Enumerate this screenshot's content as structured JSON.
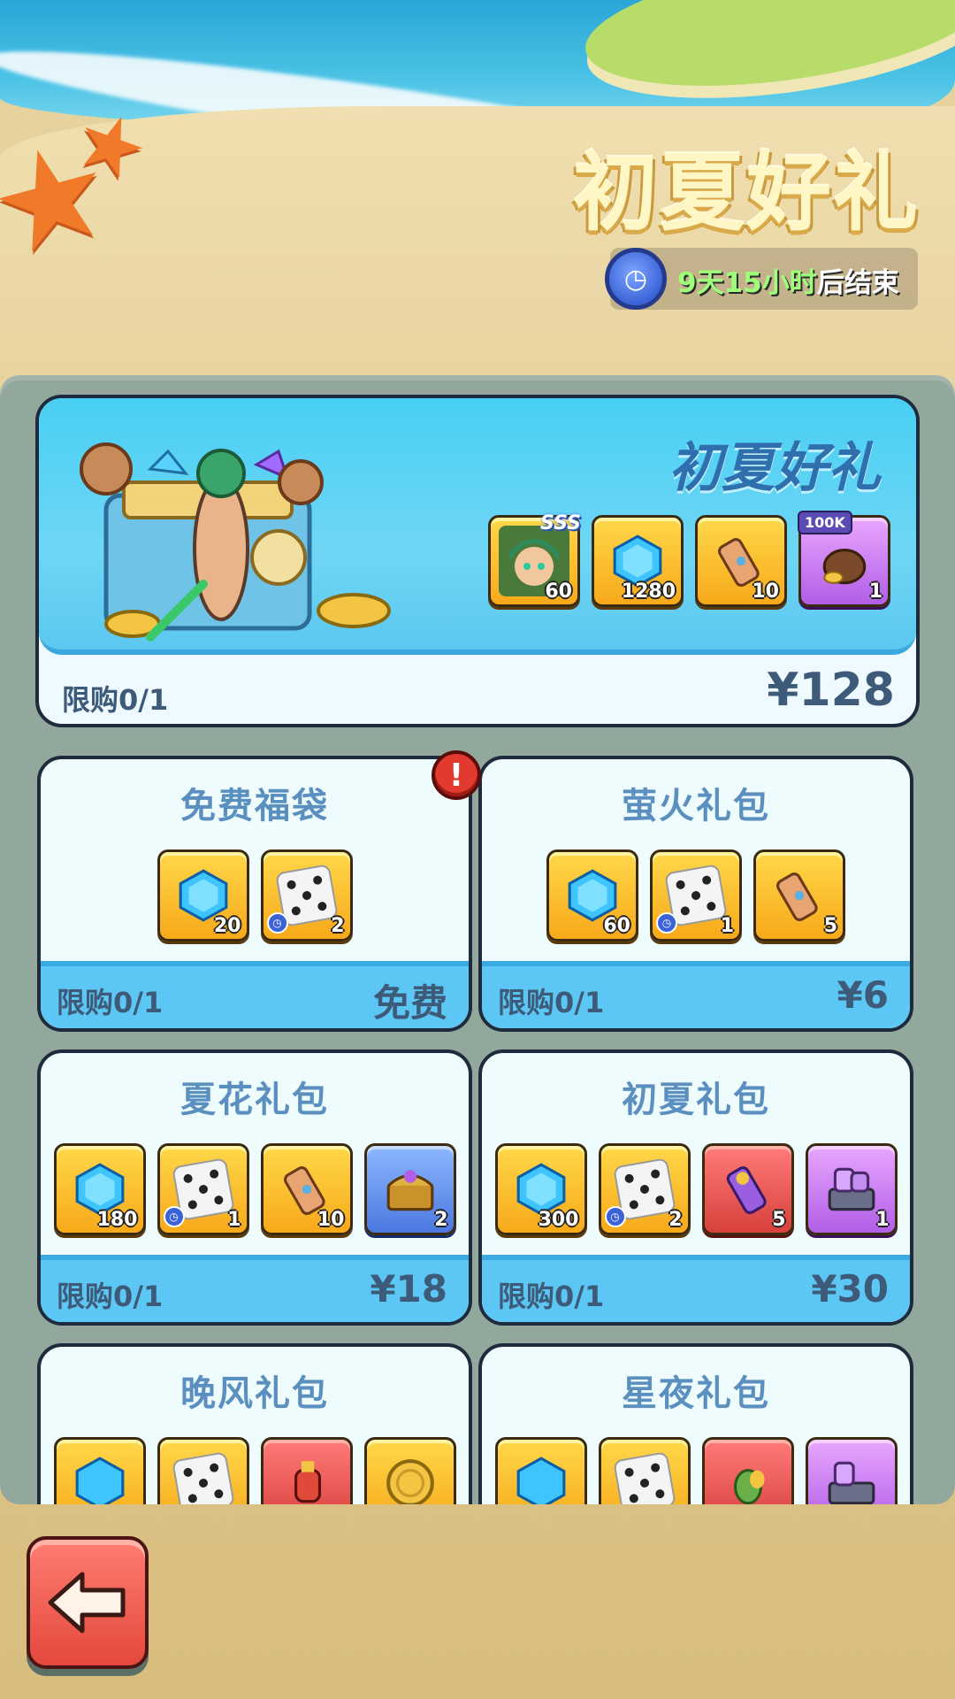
{
  "header": {
    "title": "初夏好礼",
    "timer_highlight": "9天15小时",
    "timer_suffix": "后结束"
  },
  "featured": {
    "title": "初夏好礼",
    "limit": "限购0/1",
    "price": "¥128",
    "items": [
      {
        "icon": "hero-portrait-icon",
        "qty": "60",
        "badge_right": "SSS"
      },
      {
        "icon": "blue-gem-icon",
        "qty": "1280"
      },
      {
        "icon": "scroll-icon",
        "qty": "10"
      },
      {
        "icon": "coin-bag-icon",
        "qty": "1",
        "badge_left": "100K"
      }
    ]
  },
  "packs": [
    {
      "title": "免费福袋",
      "limit": "限购0/1",
      "price": "免费",
      "items": [
        {
          "icon": "blue-gem-icon",
          "qty": "20"
        },
        {
          "icon": "dice-icon",
          "qty": "2",
          "timed": true
        }
      ]
    },
    {
      "title": "萤火礼包",
      "limit": "限购0/1",
      "price": "¥6",
      "items": [
        {
          "icon": "blue-gem-icon",
          "qty": "60"
        },
        {
          "icon": "dice-icon",
          "qty": "1",
          "timed": true
        },
        {
          "icon": "scroll-icon",
          "qty": "5"
        }
      ]
    },
    {
      "title": "夏花礼包",
      "limit": "限购0/1",
      "price": "¥18",
      "items": [
        {
          "icon": "blue-gem-icon",
          "qty": "180"
        },
        {
          "icon": "dice-icon",
          "qty": "1",
          "timed": true
        },
        {
          "icon": "scroll-icon",
          "qty": "10"
        },
        {
          "icon": "treasure-chest-icon",
          "qty": "2"
        }
      ]
    },
    {
      "title": "初夏礼包",
      "limit": "限购0/1",
      "price": "¥30",
      "items": [
        {
          "icon": "blue-gem-icon",
          "qty": "300"
        },
        {
          "icon": "dice-icon",
          "qty": "2",
          "timed": true
        },
        {
          "icon": "purple-scroll-icon",
          "qty": "5"
        },
        {
          "icon": "mask-chest-icon",
          "qty": "1"
        }
      ]
    },
    {
      "title": "晚风礼包",
      "items": [
        {
          "icon": "blue-gem-icon"
        },
        {
          "icon": "dice-icon"
        },
        {
          "icon": "potion-icon"
        },
        {
          "icon": "gold-coin-icon"
        }
      ]
    },
    {
      "title": "星夜礼包",
      "items": [
        {
          "icon": "blue-gem-icon"
        },
        {
          "icon": "dice-icon"
        },
        {
          "icon": "seed-icon"
        },
        {
          "icon": "mask-chest-icon"
        }
      ]
    }
  ],
  "colors": {
    "panel": "#93a89d",
    "card_bg": "#eefcfd",
    "card_footer": "#5cc6f4",
    "tile_gold": "#f7a91a",
    "text_muted": "#3d5b78",
    "back_button": "#e4483d"
  }
}
